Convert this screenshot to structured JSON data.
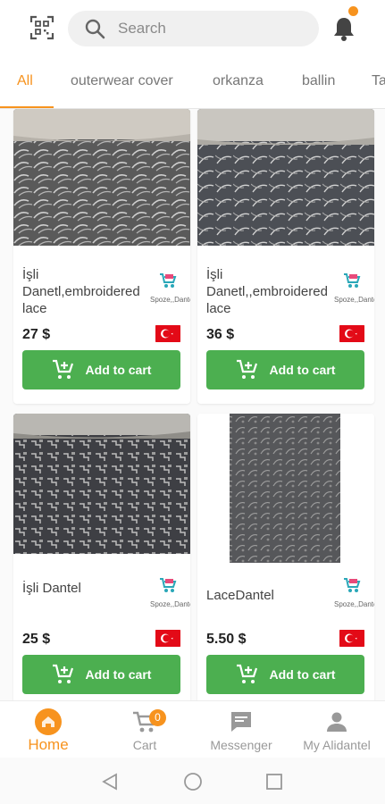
{
  "search": {
    "placeholder": "Search"
  },
  "tabs": [
    {
      "label": "All",
      "active": true
    },
    {
      "label": "outerwear cover"
    },
    {
      "label": "orkanza"
    },
    {
      "label": "ballin"
    },
    {
      "label": "Ta"
    }
  ],
  "products": [
    {
      "title": "İşli Danetl,embroidered lace",
      "price": "27 $",
      "seller": "Spoze,,Dantel",
      "add_label": "Add to cart",
      "origin_flag": "turkey-flag"
    },
    {
      "title": "İşli Danetl,,embroidered lace",
      "price": "36 $",
      "seller": "Spoze,,Dantel",
      "add_label": "Add to cart",
      "origin_flag": "turkey-flag"
    },
    {
      "title": "İşli Dantel",
      "price": "25 $",
      "seller": "Spoze,,Dantel",
      "add_label": "Add to cart",
      "origin_flag": "turkey-flag"
    },
    {
      "title": "LaceDantel",
      "price": "5.50 $",
      "seller": "Spoze,,Dantel",
      "add_label": "Add to cart",
      "origin_flag": "turkey-flag"
    }
  ],
  "bottom_nav": [
    {
      "label": "Home",
      "icon": "home-icon",
      "active": true
    },
    {
      "label": "Cart",
      "icon": "cart-icon",
      "badge": "0"
    },
    {
      "label": "Messenger",
      "icon": "message-icon"
    },
    {
      "label": "My Alidantel",
      "icon": "person-icon"
    }
  ],
  "colors": {
    "accent": "#f7931e",
    "add_button": "#4caf50",
    "flag_red": "#e30a17"
  }
}
